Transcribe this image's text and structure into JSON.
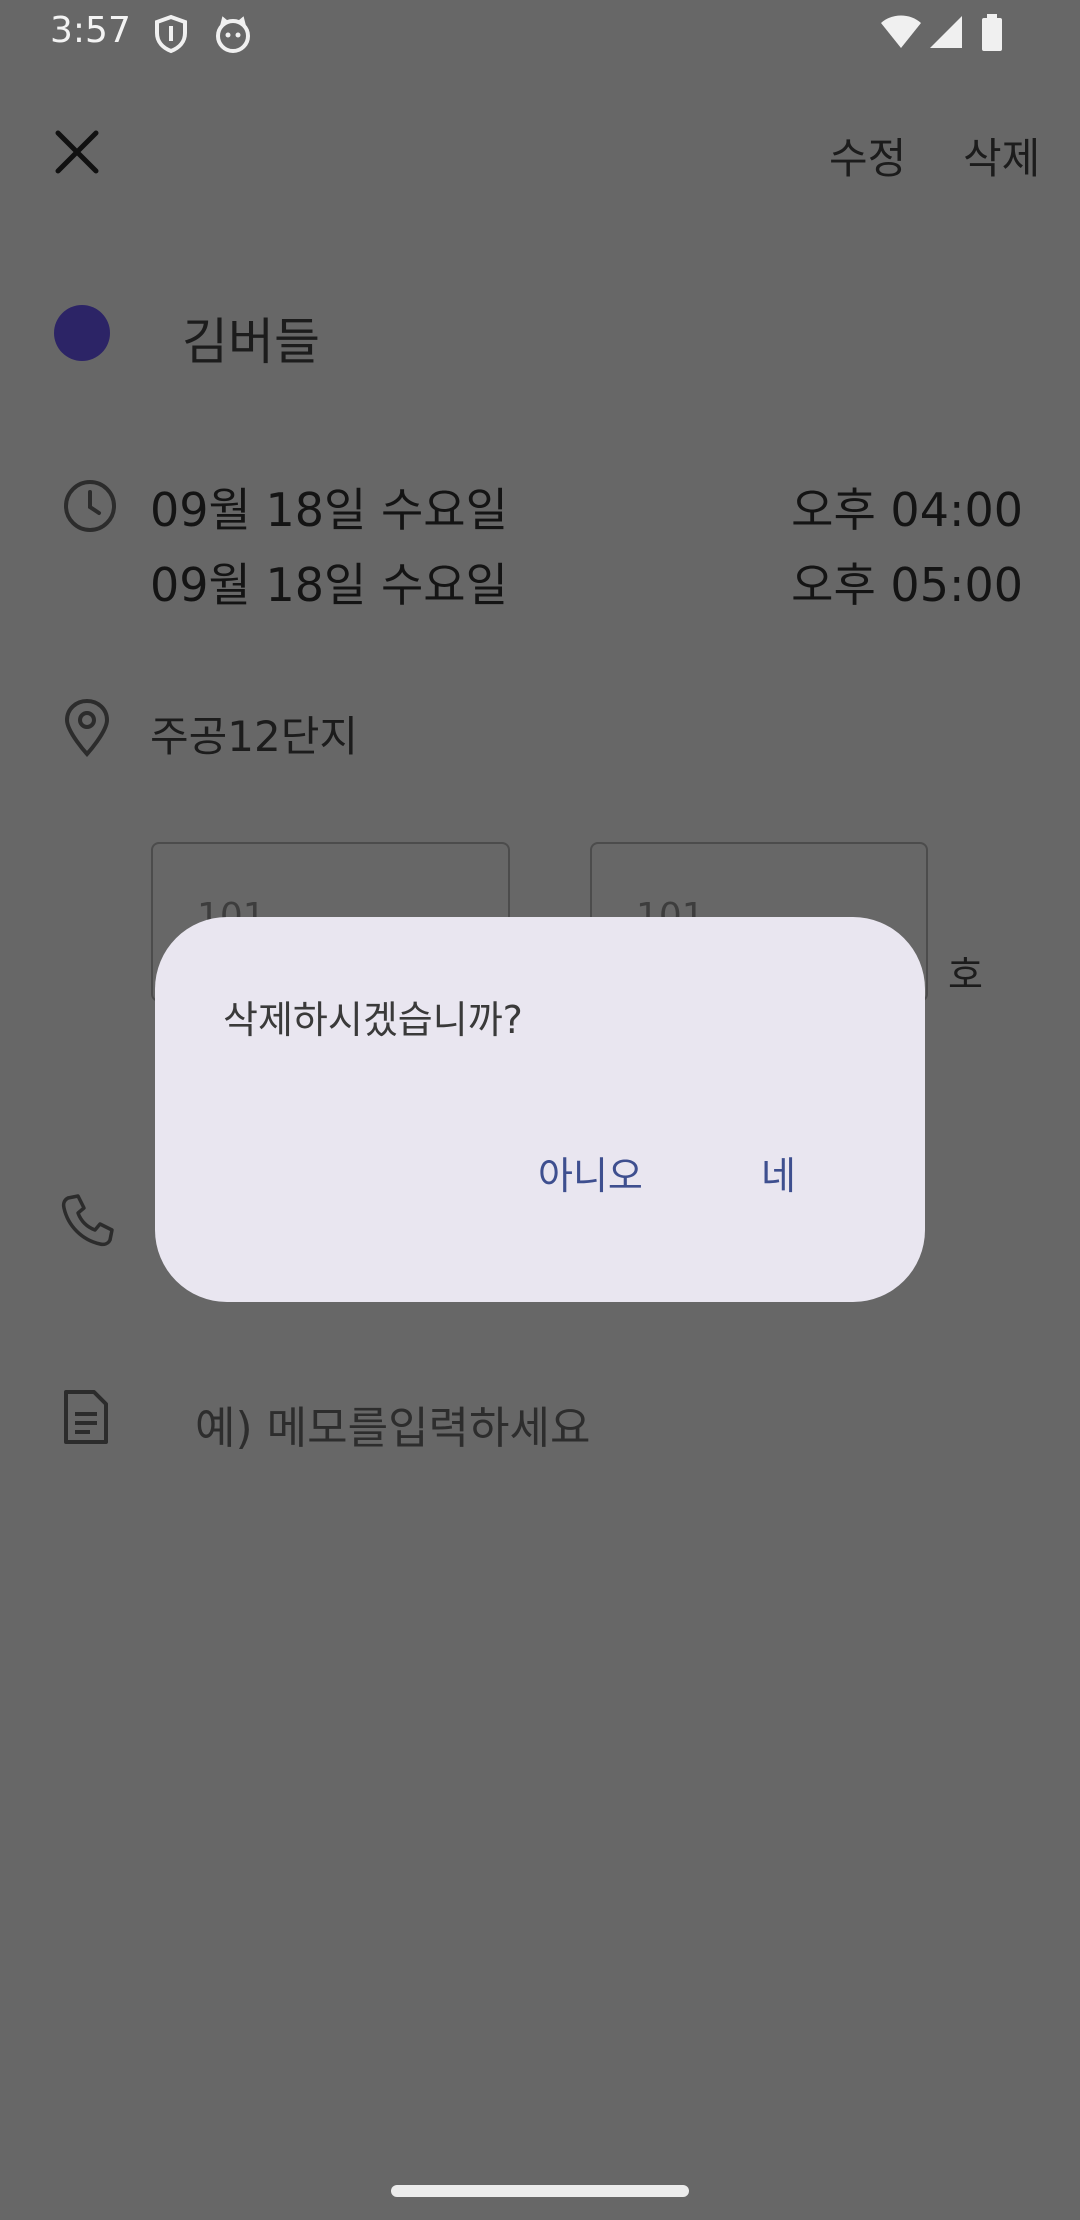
{
  "status_bar": {
    "time": "3:57",
    "icons": [
      "shield-icon",
      "cat-icon",
      "wifi-icon",
      "signal-icon",
      "battery-icon"
    ]
  },
  "app_bar": {
    "close_icon": "close-icon",
    "edit_label": "수정",
    "delete_label": "삭제"
  },
  "event": {
    "color": "#2c2466",
    "title": "김버들",
    "start_date": "09월 18일 수요일",
    "start_time": "오후 04:00",
    "end_date": "09월 18일 수요일",
    "end_time": "오후 05:00",
    "location": "주공12단지",
    "building_value": "101",
    "unit_value": "101",
    "unit_suffix": "호",
    "memo_placeholder": "예) 메모를입력하세요"
  },
  "dialog": {
    "message": "삭제하시겠습니까?",
    "no_label": "아니오",
    "yes_label": "네"
  },
  "colors": {
    "scrim": "#676767",
    "dialog_bg": "#e9e6f0",
    "accent_text": "#3e4f8f"
  }
}
